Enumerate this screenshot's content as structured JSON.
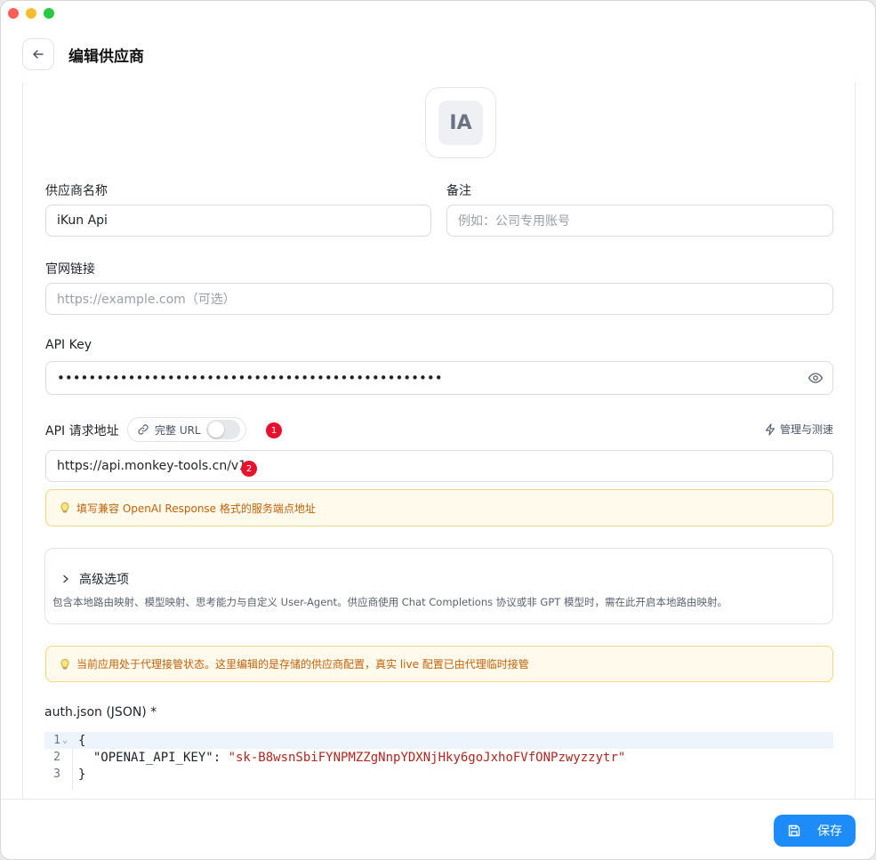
{
  "window": {
    "traffic_lights": [
      "close",
      "minimize",
      "maximize"
    ]
  },
  "header": {
    "title": "编辑供应商",
    "back_icon": "arrow-left-icon"
  },
  "logo": {
    "initials": "IA"
  },
  "form": {
    "provider_name": {
      "label": "供应商名称",
      "value": "iKun Api"
    },
    "remark": {
      "label": "备注",
      "placeholder": "例如：公司专用账号"
    },
    "website": {
      "label": "官网链接",
      "placeholder": "https://example.com（可选）"
    },
    "api_key": {
      "label": "API Key",
      "value": "•••••••••••••••••••••••••••••••••••••••••••••••••",
      "icon": "eye-icon"
    },
    "api_endpoint": {
      "label": "API 请求地址",
      "toggle_label": "完整 URL",
      "toggle_on": false,
      "badge_1": "1",
      "badge_2": "2",
      "manage_label": "管理与测速",
      "value": "https://api.monkey-tools.cn/v1"
    }
  },
  "hint_endpoint": {
    "icon": "lightbulb-icon",
    "text": "填写兼容 OpenAI Response 格式的服务端点地址"
  },
  "advanced": {
    "title": "高级选项",
    "description": "包含本地路由映射、模型映射、思考能力与自定义 User-Agent。供应商使用 Chat Completions 协议或非 GPT 模型时，需在此开启本地路由映射。"
  },
  "hint_proxy": {
    "icon": "lightbulb-icon",
    "text": "当前应用处于代理接管状态。这里编辑的是存储的供应商配置，真实 live 配置已由代理临时接管"
  },
  "auth_json": {
    "label": "auth.json (JSON) *",
    "lines": [
      {
        "no": "1",
        "fold": "⌄",
        "text": "{"
      },
      {
        "no": "2",
        "key": "  \"OPENAI_API_KEY\": ",
        "str": "\"sk-B8wsnSbiFYNPMZZgNnpYDXNjHky6goJxhoFVfONPzwyzzytr\""
      },
      {
        "no": "3",
        "text": "}"
      }
    ]
  },
  "footer": {
    "save_label": "保存",
    "save_icon": "save-icon",
    "accent": "#1d8cf8"
  }
}
